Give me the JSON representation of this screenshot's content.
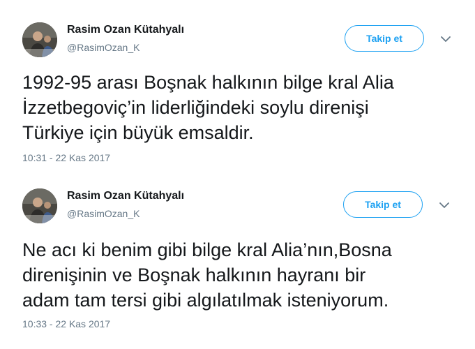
{
  "tweets": [
    {
      "author_name": "Rasim Ozan Kütahyalı",
      "handle": "@RasimOzan_K",
      "follow_label": "Takip et",
      "text_lines": [
        "1992-95 arası Boşnak halkının bilge kral Alia",
        "İzzetbegoviç’in liderliğindeki soylu direnişi",
        "Türkiye için büyük emsaldir."
      ],
      "timestamp": "10:31 - 22 Kas 2017"
    },
    {
      "author_name": "Rasim Ozan Kütahyalı",
      "handle": "@RasimOzan_K",
      "follow_label": "Takip et",
      "text_lines": [
        "Ne acı ki benim gibi bilge kral Alia’nın,Bosna",
        "direnişinin ve Boşnak halkının hayranı bir",
        "adam tam tersi gibi algılatılmak isteniyorum."
      ],
      "timestamp": "10:33 - 22 Kas 2017"
    }
  ],
  "icons": {
    "avatar": "avatar-photo",
    "menu": "chevron-down-icon"
  },
  "colors": {
    "accent": "#1da1f2",
    "secondary_text": "#657786",
    "primary_text": "#14171a"
  }
}
